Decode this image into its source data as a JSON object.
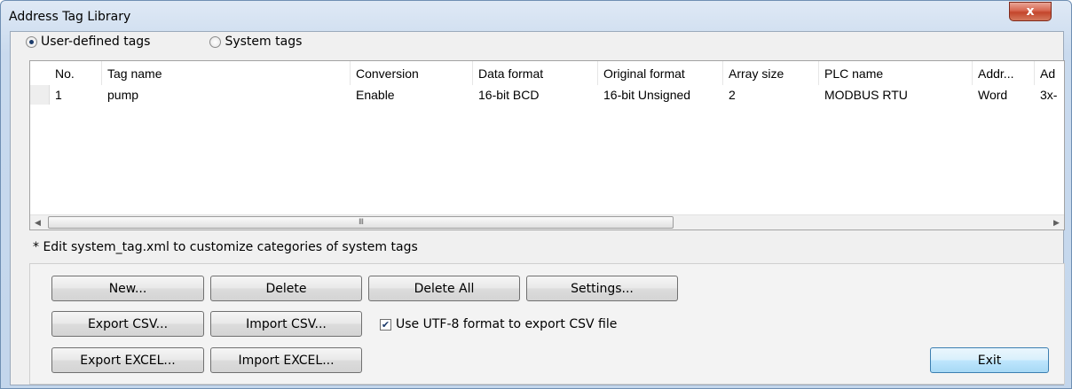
{
  "window": {
    "title": "Address Tag Library",
    "close_glyph": "x"
  },
  "tag_type": {
    "options": [
      {
        "label": "User-defined tags",
        "selected": true
      },
      {
        "label": "System tags",
        "selected": false
      }
    ]
  },
  "table": {
    "columns": [
      "No.",
      "Tag name",
      "Conversion",
      "Data format",
      "Original format",
      "Array size",
      "PLC name",
      "Addr...",
      "Ad"
    ],
    "rows": [
      {
        "no": "1",
        "tag_name": "pump",
        "conversion": "Enable",
        "data_format": "16-bit BCD",
        "original_format": "16-bit Unsigned",
        "array_size": "2",
        "plc_name": "MODBUS RTU",
        "addr": "Word",
        "ad": "3x-"
      }
    ],
    "scroll_left_glyph": "◀",
    "scroll_right_glyph": "▶",
    "thumb_grip": "III"
  },
  "note": "* Edit system_tag.xml to customize categories of system tags",
  "buttons": {
    "new": "New...",
    "delete": "Delete",
    "delete_all": "Delete All",
    "settings": "Settings...",
    "export_csv": "Export CSV...",
    "import_csv": "Import CSV...",
    "export_excel": "Export EXCEL...",
    "import_excel": "Import EXCEL...",
    "exit": "Exit"
  },
  "utf8_option": {
    "label": "Use UTF-8 format to export CSV file",
    "checked": true,
    "check_glyph": "✔"
  }
}
